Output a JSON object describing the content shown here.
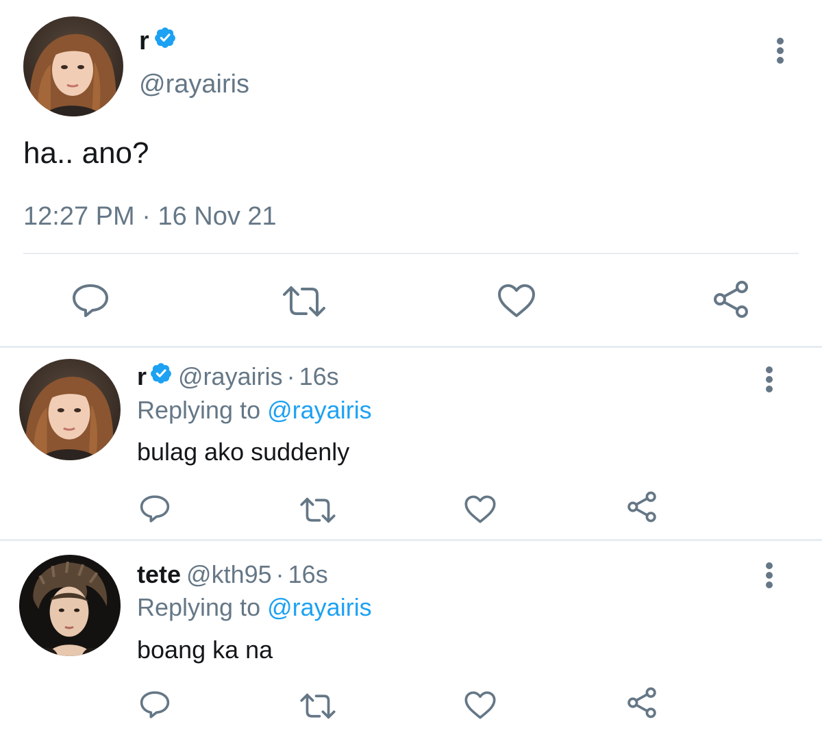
{
  "main_tweet": {
    "display_name": "r",
    "handle": "@rayairis",
    "text": "ha.. ano?",
    "time": "12:27 PM",
    "separator": "·",
    "date": "16 Nov 21",
    "verified": true
  },
  "replies": [
    {
      "display_name": "r",
      "verified": true,
      "handle": "@rayairis",
      "separator": "·",
      "time": "16s",
      "replying_prefix": "Replying to",
      "replying_to": "@rayairis",
      "text": "bulag ako suddenly"
    },
    {
      "display_name": "tete",
      "verified": false,
      "handle": "@kth95",
      "separator": "·",
      "time": "16s",
      "replying_prefix": "Replying to",
      "replying_to": "@rayairis",
      "text": "boang ka na"
    }
  ],
  "icons": {
    "reply": "reply-icon",
    "retweet": "retweet-icon",
    "like": "like-icon",
    "share": "share-icon",
    "more": "more-options-icon",
    "verified": "verified-badge-icon"
  },
  "colors": {
    "accent": "#1da1f2",
    "secondary_text": "#657786",
    "primary_text": "#14171a",
    "divider": "#e6ecf0"
  }
}
